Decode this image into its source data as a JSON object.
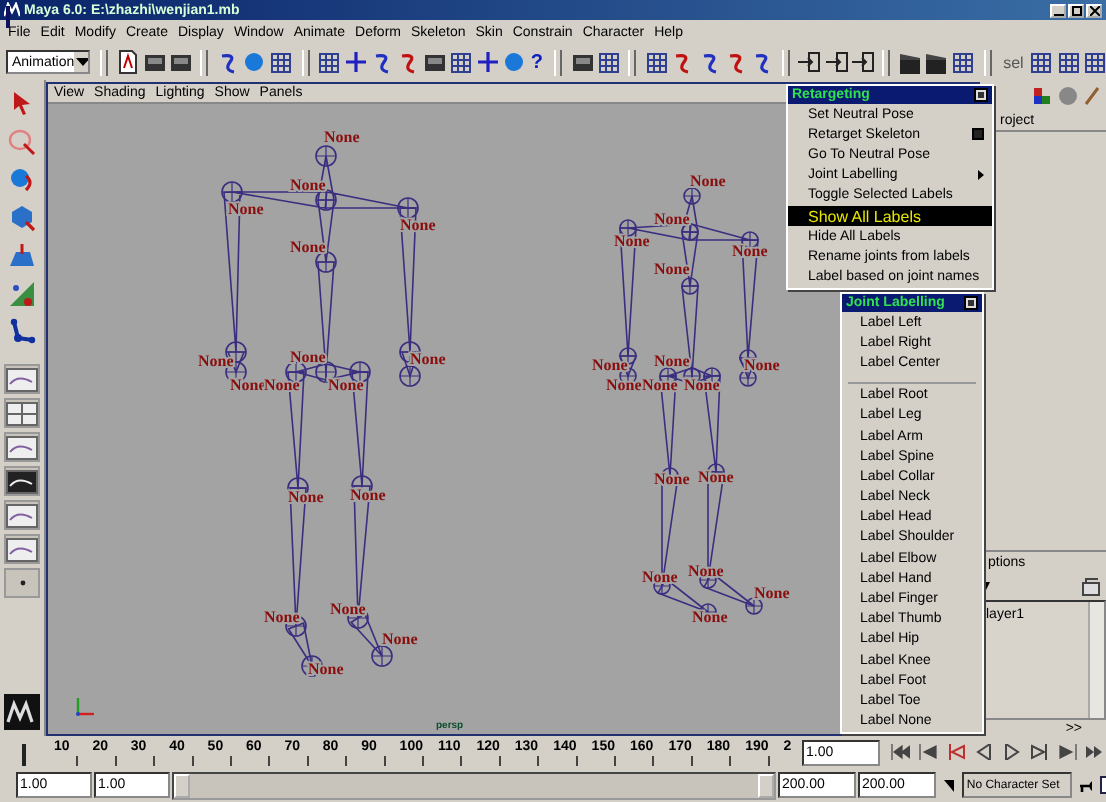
{
  "window": {
    "title": "Maya 6.0: E:\\zhazhi\\wenjian1.mb"
  },
  "menu_bar": [
    "File",
    "Edit",
    "Modify",
    "Create",
    "Display",
    "Window",
    "Animate",
    "Deform",
    "Skeleton",
    "Skin",
    "Constrain",
    "Character",
    "Help"
  ],
  "toolbar": {
    "menu_set": "Animation",
    "help_glyph": "?",
    "sel_label": "sel"
  },
  "viewport": {
    "menus": [
      "View",
      "Shading",
      "Lighting",
      "Show",
      "Panels"
    ],
    "joint_labels": [
      "None",
      "None",
      "None",
      "None",
      "None",
      "None",
      "None",
      "None",
      "None",
      "None",
      "None",
      "None",
      "None",
      "None",
      "None",
      "None",
      "None",
      "None",
      "None",
      "None",
      "None",
      "None",
      "None",
      "None",
      "None",
      "None",
      "None",
      "None",
      "None",
      "None",
      "None",
      "None",
      "None",
      "None"
    ],
    "camera": "persp"
  },
  "retargeting_menu": {
    "title": "Retargeting",
    "items": [
      {
        "label": "Set Neutral Pose",
        "kind": "item",
        "selected": false
      },
      {
        "label": "Retarget Skeleton",
        "kind": "option",
        "selected": false
      },
      {
        "label": "Go To Neutral Pose",
        "kind": "item",
        "selected": false
      },
      {
        "label": "Joint Labelling",
        "kind": "submenu",
        "selected": false
      },
      {
        "label": "Toggle Selected Labels",
        "kind": "item",
        "selected": false
      },
      {
        "label": "Show All Labels",
        "kind": "item",
        "selected": true
      },
      {
        "label": "Hide All Labels",
        "kind": "item",
        "selected": false
      },
      {
        "label": "Rename joints from labels",
        "kind": "item",
        "selected": false
      },
      {
        "label": "Label based on joint names",
        "kind": "item",
        "selected": false
      }
    ]
  },
  "joint_labelling_menu": {
    "title": "Joint Labelling",
    "items": [
      {
        "label": "Label Left",
        "kind": "item"
      },
      {
        "label": "Label Right",
        "kind": "item"
      },
      {
        "label": "Label Center",
        "kind": "item"
      },
      {
        "kind": "separator"
      },
      {
        "label": "Label Root",
        "kind": "item"
      },
      {
        "label": "Label Leg",
        "kind": "item"
      },
      {
        "label": "Label Arm",
        "kind": "item"
      },
      {
        "label": "Label Spine",
        "kind": "item"
      },
      {
        "label": "Label Collar",
        "kind": "item"
      },
      {
        "label": "Label Neck",
        "kind": "item"
      },
      {
        "label": "Label Head",
        "kind": "item"
      },
      {
        "label": "Label Shoulder",
        "kind": "item"
      },
      {
        "label": "Label Elbow",
        "kind": "item"
      },
      {
        "label": "Label Hand",
        "kind": "item"
      },
      {
        "label": "Label Finger",
        "kind": "item"
      },
      {
        "label": "Label Thumb",
        "kind": "item"
      },
      {
        "label": "Label Hip",
        "kind": "item"
      },
      {
        "label": "Label Knee",
        "kind": "item"
      },
      {
        "label": "Label Foot",
        "kind": "item"
      },
      {
        "label": "Label Toe",
        "kind": "item"
      },
      {
        "label": "Label None",
        "kind": "item"
      }
    ]
  },
  "channel_box": {
    "tab_text": "roject"
  },
  "layer_editor": {
    "options_text": "ptions",
    "layers": [
      "layer1"
    ],
    "more": ">>"
  },
  "time_slider": {
    "ticks": [
      "10",
      "20",
      "30",
      "40",
      "50",
      "60",
      "70",
      "80",
      "90",
      "100",
      "110",
      "120",
      "130",
      "140",
      "150",
      "160",
      "170",
      "180",
      "190",
      "2"
    ],
    "current_time": "1.00"
  },
  "range_slider": {
    "start_time": "1.00",
    "playback_start": "1.00",
    "playback_end": "200.00",
    "end_time": "200.00",
    "character_set": "No Character Set",
    "level": 1
  }
}
